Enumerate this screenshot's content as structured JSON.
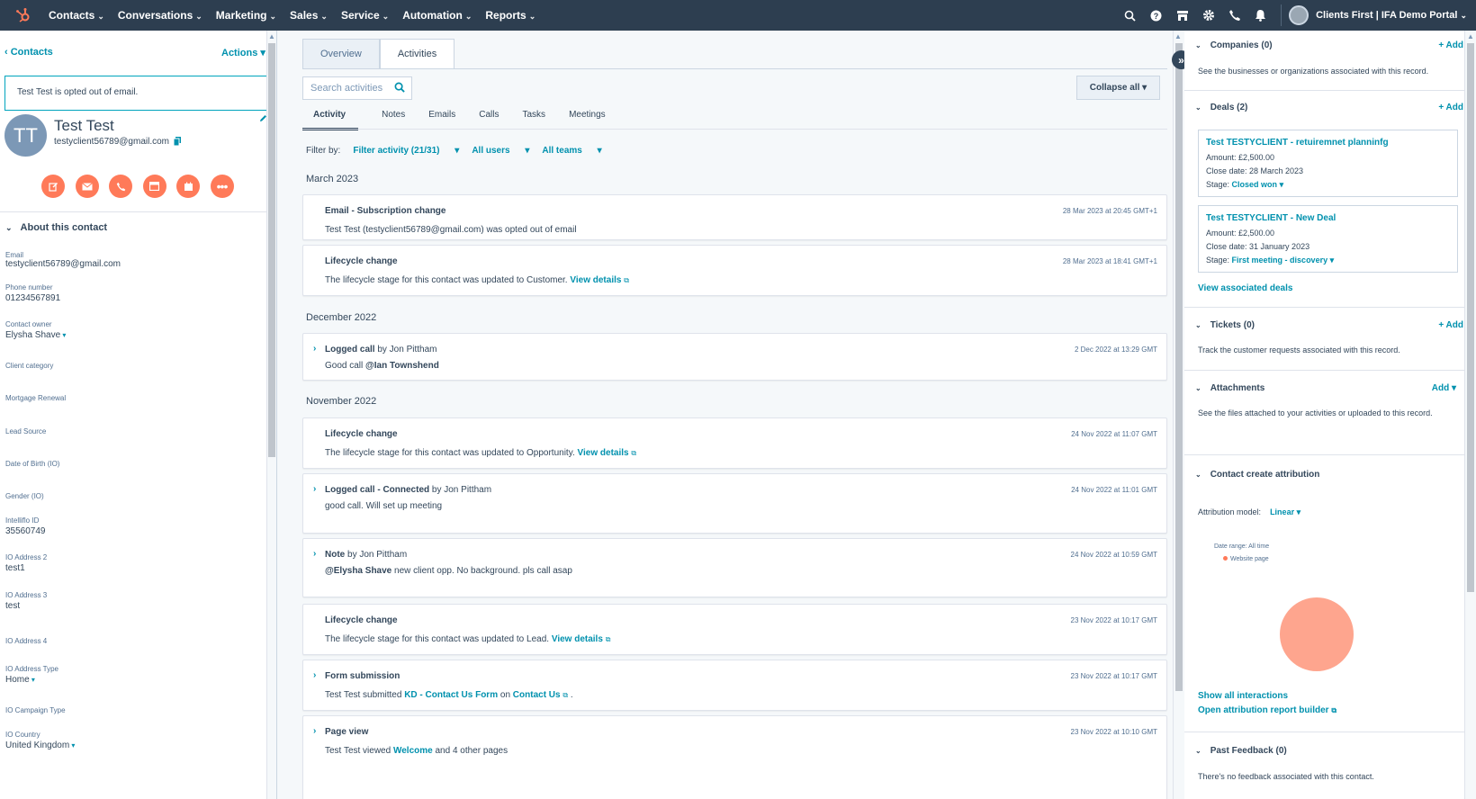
{
  "nav": {
    "items": [
      "Contacts",
      "Conversations",
      "Marketing",
      "Sales",
      "Service",
      "Automation",
      "Reports"
    ],
    "portal": "Clients First | IFA Demo Portal"
  },
  "left": {
    "breadcrumb": "Contacts",
    "actions": "Actions",
    "optout": "Test Test is opted out of email.",
    "initials": "TT",
    "name": "Test Test",
    "email": "testyclient56789@gmail.com",
    "about_title": "About this contact",
    "props": [
      {
        "label": "Email",
        "value": "testyclient56789@gmail.com",
        "dd": false
      },
      {
        "label": "Phone number",
        "value": "01234567891",
        "dd": false
      },
      {
        "label": "Contact owner",
        "value": "Elysha Shave",
        "dd": true
      },
      {
        "label": "Client category",
        "value": "",
        "dd": false
      },
      {
        "label": "Mortgage Renewal",
        "value": "",
        "dd": false
      },
      {
        "label": "Lead Source",
        "value": "",
        "dd": false
      },
      {
        "label": "Date of Birth (IO)",
        "value": "",
        "dd": false
      },
      {
        "label": "Gender (IO)",
        "value": "",
        "dd": false
      },
      {
        "label": "Intelliflo ID",
        "value": "35560749",
        "dd": false
      },
      {
        "label": "IO Address 2",
        "value": "test1",
        "dd": false
      },
      {
        "label": "IO Address 3",
        "value": "test",
        "dd": false
      },
      {
        "label": "IO Address 4",
        "value": "",
        "dd": false
      },
      {
        "label": "IO Address Type",
        "value": "Home",
        "dd": true
      },
      {
        "label": "IO Campaign Type",
        "value": "",
        "dd": false
      },
      {
        "label": "IO Country",
        "value": "United Kingdom",
        "dd": true
      }
    ]
  },
  "mid": {
    "tabs": [
      "Overview",
      "Activities"
    ],
    "search_placeholder": "Search activities",
    "collapse": "Collapse all",
    "subtabs": [
      "Activity",
      "Notes",
      "Emails",
      "Calls",
      "Tasks",
      "Meetings"
    ],
    "filter_label": "Filter by:",
    "filter_activity": "Filter activity (21/31)",
    "filter_users": "All users",
    "filter_teams": "All teams",
    "months": [
      "March 2023",
      "December 2022",
      "November 2022"
    ],
    "cards": [
      {
        "title": "Email - Subscription change",
        "by": "",
        "date": "28 Mar 2023 at 20:45 GMT+1",
        "body": "Test Test (testyclient56789@gmail.com) was opted out of email"
      },
      {
        "title": "Lifecycle change",
        "by": "",
        "date": "28 Mar 2023 at 18:41 GMT+1",
        "body": "The lifecycle stage for this contact was updated to Customer.",
        "link": "View details"
      },
      {
        "title": "Logged call",
        "by": " by Jon Pittham",
        "date": "2 Dec 2022 at 13:29 GMT",
        "body": "Good  call",
        "mention": "@Ian Townshend"
      },
      {
        "title": "Lifecycle change",
        "by": "",
        "date": "24 Nov 2022 at 11:07 GMT",
        "body": "The lifecycle stage for this contact was updated to Opportunity.",
        "link": "View details"
      },
      {
        "title": "Logged call - Connected",
        "by": " by Jon Pittham",
        "date": "24 Nov 2022 at 11:01 GMT",
        "body": "good call. Will set up meeting"
      },
      {
        "title": "Note",
        "by": " by Jon Pittham",
        "date": "24 Nov 2022 at 10:59 GMT",
        "mention": "@Elysha Shave",
        "body": " new client opp. No background. pls call asap"
      },
      {
        "title": "Lifecycle change",
        "by": "",
        "date": "23 Nov 2022 at 10:17 GMT",
        "body": "The lifecycle stage for this contact was updated to Lead.",
        "link": "View details"
      },
      {
        "title": "Form submission",
        "by": "",
        "date": "23 Nov 2022 at 10:17 GMT",
        "body": "Test Test submitted",
        "link1": "KD - Contact Us Form",
        "on": " on ",
        "link2": "Contact Us",
        "end": " ."
      },
      {
        "title": "Page view",
        "by": "",
        "date": "23 Nov 2022 at 10:10 GMT",
        "body": "Test Test viewed",
        "link": "Welcome",
        "end": " and 4 other pages"
      }
    ]
  },
  "right": {
    "companies": {
      "title": "Companies (0)",
      "add": "+ Add",
      "text": "See the businesses or organizations associated with this record."
    },
    "deals": {
      "title": "Deals (2)",
      "add": "+ Add",
      "items": [
        {
          "name": "Test TESTYCLIENT - retuiremnet planninfg",
          "amount": "Amount: £2,500.00",
          "close": "Close date: 28 March 2023",
          "stage_label": "Stage:",
          "stage": "Closed won"
        },
        {
          "name": "Test TESTYCLIENT - New Deal",
          "amount": "Amount: £2,500.00",
          "close": "Close date: 31 January 2023",
          "stage_label": "Stage:",
          "stage": "First meeting - discovery"
        }
      ],
      "view": "View associated deals"
    },
    "tickets": {
      "title": "Tickets (0)",
      "add": "+ Add",
      "text": "Track the customer requests associated with this record."
    },
    "attachments": {
      "title": "Attachments",
      "add": "Add",
      "text": "See the files attached to your activities or uploaded to this record."
    },
    "attribution": {
      "title": "Contact create attribution",
      "model_label": "Attribution model:",
      "model": "Linear",
      "range": "Date range: All time",
      "legend": "Website page",
      "show": "Show all interactions",
      "open": "Open attribution report builder"
    },
    "feedback": {
      "title": "Past Feedback (0)",
      "text": "There's no feedback associated with this contact."
    }
  },
  "colors": {
    "nav": "#2d3e50",
    "accent": "#0091ae",
    "orange": "#ff7a59",
    "slice": "#fea58e"
  }
}
